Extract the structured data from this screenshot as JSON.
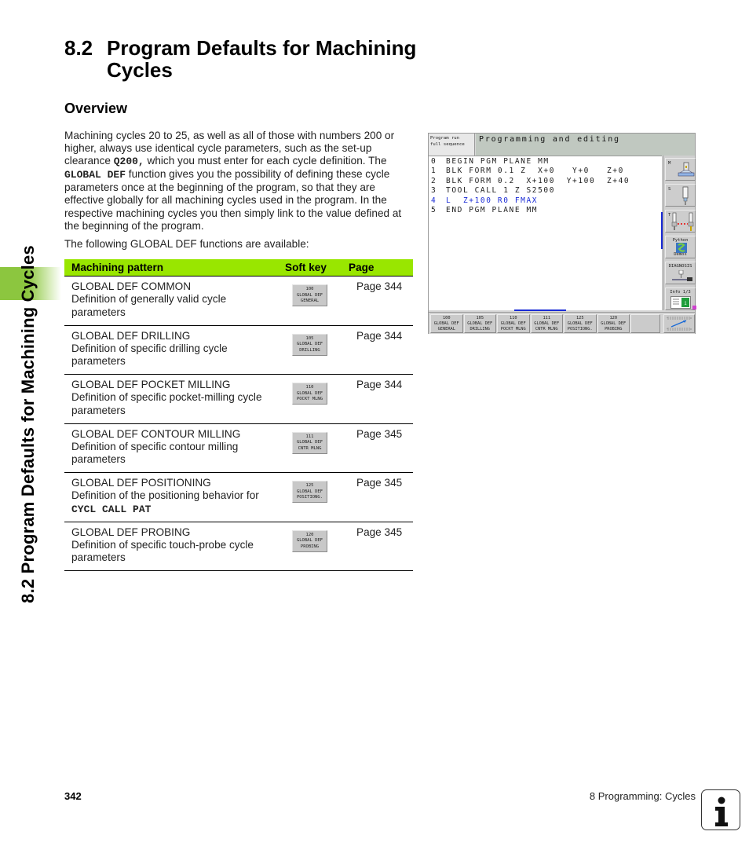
{
  "side_tab": {
    "label": "8.2 Program Defaults for Machining Cycles"
  },
  "heading": {
    "number": "8.2",
    "title": "Program Defaults for Machining Cycles"
  },
  "subheading": "Overview",
  "intro": {
    "part1": "Machining cycles 20 to 25, as well as all of those with numbers 200 or higher, always use identical cycle parameters, such as the set-up clearance ",
    "code1": "Q200,",
    "part2": " which you must enter for each cycle definition. The ",
    "code2": "GLOBAL DEF",
    "part3": " function gives you the possibility of defining these cycle parameters once at the beginning of the program, so that they are effective globally for all machining cycles used in the program. In the respective machining cycles you then simply link to the value defined at the beginning of the program."
  },
  "available_text": "The following GLOBAL DEF functions are available:",
  "table": {
    "headers": [
      "Machining pattern",
      "Soft key",
      "Page"
    ],
    "rows": [
      {
        "title": "GLOBAL DEF COMMON",
        "desc": "Definition of generally valid cycle parameters",
        "desc_code": "",
        "softkey": [
          "100",
          "GLOBAL DEF",
          "GENERAL"
        ],
        "page": "Page 344"
      },
      {
        "title": "GLOBAL DEF DRILLING",
        "desc": "Definition of specific drilling cycle parameters",
        "desc_code": "",
        "softkey": [
          "105",
          "GLOBAL DEF",
          "DRILLING"
        ],
        "page": "Page 344"
      },
      {
        "title": "GLOBAL DEF POCKET MILLING",
        "desc": "Definition of specific pocket-milling cycle parameters",
        "desc_code": "",
        "softkey": [
          "110",
          "GLOBAL DEF",
          "POCKT MLNG"
        ],
        "page": "Page 344"
      },
      {
        "title": "GLOBAL DEF CONTOUR MILLING",
        "desc": "Definition of specific contour milling parameters",
        "desc_code": "",
        "softkey": [
          "111",
          "GLOBAL DEF",
          "CNTR MLNG"
        ],
        "page": "Page 345"
      },
      {
        "title": "GLOBAL DEF POSITIONING",
        "desc": "Definition of the positioning behavior for ",
        "desc_code": "CYCL CALL PAT",
        "softkey": [
          "125",
          "GLOBAL DEF",
          "POSITIONG."
        ],
        "page": "Page 345"
      },
      {
        "title": "GLOBAL DEF PROBING",
        "desc": "Definition of specific touch-probe cycle parameters",
        "desc_code": "",
        "softkey": [
          "120",
          "GLOBAL DEF",
          "PROBING"
        ],
        "page": "Page 345"
      }
    ]
  },
  "cnc_screen": {
    "mode_line1": "Program run",
    "mode_line2": "full sequence",
    "header": "Programming and editing",
    "program_lines": [
      {
        "n": "0",
        "text": "BEGIN PGM PLANE MM",
        "active": false
      },
      {
        "n": "1",
        "text": "BLK FORM 0.1 Z  X+0   Y+0   Z+0",
        "active": false
      },
      {
        "n": "2",
        "text": "BLK FORM 0.2  X+100  Y+100  Z+40",
        "active": false
      },
      {
        "n": "3",
        "text": "TOOL CALL 1 Z S2500",
        "active": false
      },
      {
        "n": "4",
        "text": "L  Z+100 R0 FMAX",
        "active": true
      },
      {
        "n": "5",
        "text": "END PGM PLANE MM",
        "active": false
      }
    ],
    "vertical_keys": [
      {
        "label": "M",
        "icon": "machine-icon"
      },
      {
        "label": "S",
        "icon": "spindle-icon"
      },
      {
        "label": "T",
        "icon": "tool-icon"
      },
      {
        "label_top": "Python",
        "label_bottom": "Demos",
        "icon": "python-icon"
      },
      {
        "label_top": "DIAGNOSIS",
        "icon": "diagnosis-icon"
      },
      {
        "label_top": "Info 1/3",
        "icon": "info-icon"
      }
    ],
    "softkeys": [
      [
        "100",
        "GLOBAL DEF",
        "GENERAL"
      ],
      [
        "105",
        "GLOBAL DEF",
        "DRILLING"
      ],
      [
        "110",
        "GLOBAL DEF",
        "POCKT MLNG"
      ],
      [
        "111",
        "GLOBAL DEF",
        "CNTR MLNG"
      ],
      [
        "125",
        "GLOBAL DEF",
        "POSITIONG."
      ],
      [
        "120",
        "GLOBAL DEF",
        "PROBING"
      ],
      [
        "",
        "",
        ""
      ]
    ],
    "active_line_color": "#1a2bd6"
  },
  "footer": {
    "page_number": "342",
    "chapter": "8 Programming: Cycles",
    "icon": "info-icon"
  },
  "colors": {
    "accent_green": "#99e600",
    "side_band_green": "#8cc63f"
  }
}
